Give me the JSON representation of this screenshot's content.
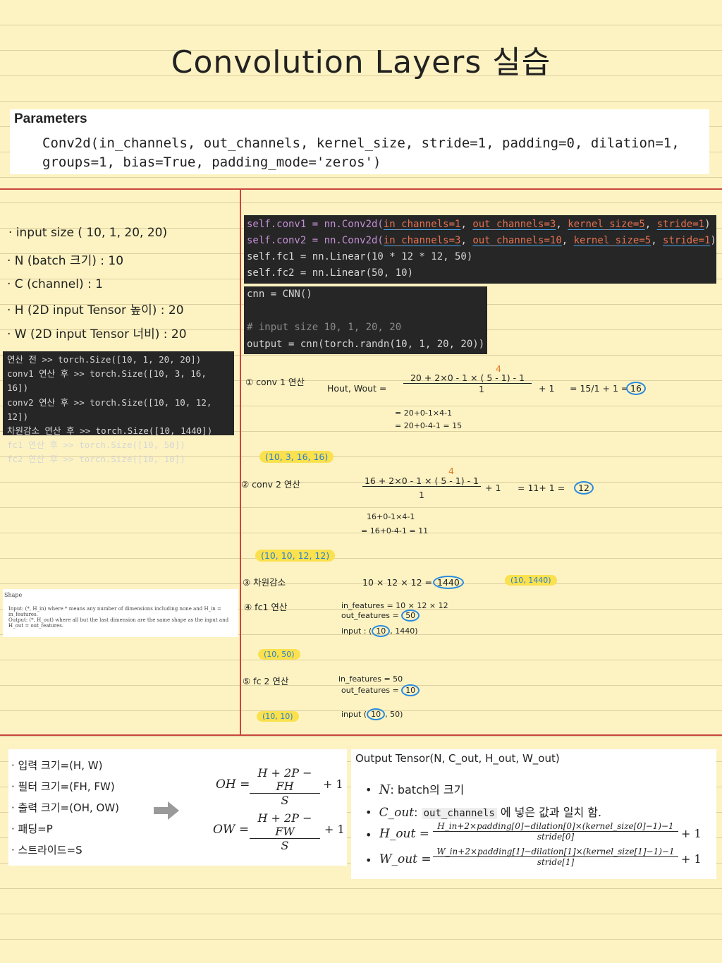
{
  "title": "Convolution Layers 실습",
  "parameters": {
    "heading": "Parameters",
    "signature_line1": "Conv2d(in_channels, out_channels, kernel_size, stride=1, padding=0, dilation=1,",
    "signature_line2": "groups=1, bias=True, padding_mode='zeros')"
  },
  "notes": [
    "· input size ( 10, 1, 20, 20)",
    "· N (batch 크기) : 10",
    "· C (channel) : 1",
    "· H (2D input Tensor 높이) : 20",
    "· W (2D input Tensor 너비) : 20"
  ],
  "log": [
    "연산 전 >> torch.Size([10, 1, 20, 20])",
    "conv1 연산 후 >> torch.Size([10, 3, 16, 16])",
    "conv2 연산 후 >> torch.Size([10, 10, 12, 12])",
    "차원감소 연산 후 >> torch.Size([10, 1440])",
    "fc1 연산 후 >> torch.Size([10, 50])",
    "fc2 연산 후 >> torch.Size([10, 10])"
  ],
  "code1": {
    "l1_prefix": "self.conv1 = nn.Conv2d(",
    "l1_a": "in_channels=1",
    "l1_b": "out_channels=3",
    "l1_c": "kernel_size=5",
    "l1_d": "stride=1",
    "l2_prefix": "self.conv2 = nn.Conv2d(",
    "l2_a": "in_channels=3",
    "l2_b": "out_channels=10",
    "l2_c": "kernel_size=5",
    "l2_d": "stride=1",
    "l3": "self.fc1 = nn.Linear(10 * 12 * 12, 50)",
    "l4": "self.fc2 = nn.Linear(50, 10)"
  },
  "code2": {
    "l1": "cnn = CNN()",
    "l2": "# input size 10, 1, 20, 20",
    "l3": "output = cnn(torch.randn(10, 1, 20, 20))"
  },
  "shape_box": {
    "heading": "Shape",
    "b1": "Input: (*, H_in) where * means any number of dimensions including none and H_in = in_features.",
    "b2": "Output: (*, H_out) where all but the last dimension are the same shape as the input and H_out = out_features."
  },
  "steps": {
    "s1_label": "① conv 1 연산",
    "s1_lhs": "Hout, Wout =",
    "s1_num": "20 + 2×0 - 1 × ( 5 - 1) - 1",
    "s1_den": "1",
    "s1_four": "4",
    "s1_tail": "+ 1",
    "s1_eq": "= 15/1 + 1 =",
    "s1_res": "16",
    "s1_line2": "= 20+0-1×4-1",
    "s1_line3": "= 20+0-4-1 = 15",
    "s1_shape": "(10, 3, 16, 16)",
    "s2_label": "② conv 2 연산",
    "s2_num": "16 + 2×0 - 1 × ( 5 - 1) - 1",
    "s2_den": "1",
    "s2_four": "4",
    "s2_tail": "+ 1",
    "s2_eq": "= 11+ 1 =",
    "s2_res": "12",
    "s2_line2": "16+0-1×4-1",
    "s2_line3": "= 16+0-4-1 = 11",
    "s2_shape": "(10, 10, 12, 12)",
    "s3_label": "③ 차원감소",
    "s3_expr": "10 × 12 × 12 =",
    "s3_res": "1440",
    "s3_shape": "(10, 1440)",
    "s4_label": "④ fc1 연산",
    "s4_in": "in_features = 10 × 12 × 12",
    "s4_out": "out_features =",
    "s4_out_v": "50",
    "s4_input": "input : (",
    "s4_input_v": "10",
    "s4_input_t": ", 1440)",
    "s4_shape": "(10, 50)",
    "s5_label": "⑤ fc 2 연산",
    "s5_in": "in_features = 50",
    "s5_out": "out_features =",
    "s5_out_v": "10",
    "s5_input": "input (",
    "s5_input_v": "10",
    "s5_input_t": ", 50)",
    "s5_shape": "(10, 10)"
  },
  "formula_left": {
    "items": [
      "· 입력 크기=(H, W)",
      "· 필터 크기=(FH, FW)",
      "· 출력 크기=(OH, OW)",
      "· 패딩=P",
      "· 스트라이드=S"
    ],
    "oh_lhs": "OH =",
    "oh_num": "H + 2P − FH",
    "oh_den": "S",
    "oh_tail": "+ 1",
    "ow_lhs": "OW =",
    "ow_num": "H + 2P − FW",
    "ow_den": "S",
    "ow_tail": "+ 1"
  },
  "formula_right": {
    "heading": "Output Tensor(N, C_out, H_out, W_out)",
    "b1_sym": "N",
    "b1_text": ": batch의 크기",
    "b2_sym": "C_out",
    "b2_code": "out_channels",
    "b2_text": "에 넣은 값과 일치 함.",
    "b3_sym": "H_out =",
    "b3_num": "H_in+2×padding[0]−dilation[0]×(kernel_size[0]−1)−1",
    "b3_den": "stride[0]",
    "b3_tail": "+ 1",
    "b4_sym": "W_out =",
    "b4_num": "W_in+2×padding[1]−dilation[1]×(kernel_size[1]−1)−1",
    "b4_den": "stride[1]",
    "b4_tail": "+ 1"
  },
  "colors": {
    "paper": "#fdf3c2",
    "red_line": "#c9453f",
    "highlight": "#fae14d",
    "circle": "#2a8ae0",
    "strike": "#e07020"
  }
}
